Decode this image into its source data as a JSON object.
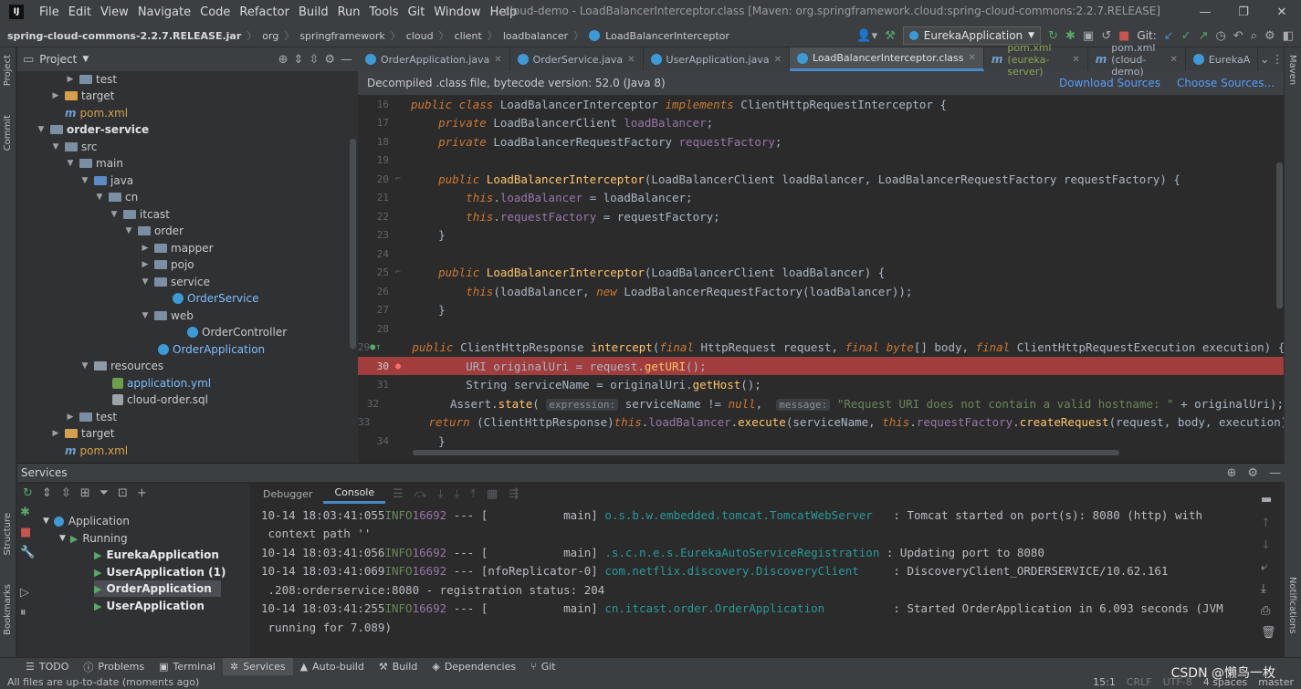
{
  "menubar": {
    "items": [
      "File",
      "Edit",
      "View",
      "Navigate",
      "Code",
      "Refactor",
      "Build",
      "Run",
      "Tools",
      "Git",
      "Window",
      "Help"
    ],
    "title": "cloud-demo - LoadBalancerInterceptor.class [Maven: org.springframework.cloud:spring-cloud-commons:2.2.7.RELEASE]"
  },
  "navbar": {
    "crumbs": [
      "spring-cloud-commons-2.2.7.RELEASE.jar",
      "org",
      "springframework",
      "cloud",
      "client",
      "loadbalancer",
      "LoadBalancerInterceptor"
    ],
    "run_config": "EurekaApplication",
    "git_label": "Git:"
  },
  "left_strip": {
    "project": "Project",
    "commit": "Commit",
    "structure": "Structure",
    "bookmarks": "Bookmarks"
  },
  "right_strip": {
    "maven": "Maven",
    "notifications": "Notifications"
  },
  "project": {
    "title": "Project",
    "tree": [
      {
        "label": "test",
        "icon": "folder"
      },
      {
        "label": "target",
        "icon": "folder-target"
      },
      {
        "label": "pom.xml",
        "icon": "maven"
      },
      {
        "label": "order-service",
        "icon": "module"
      },
      {
        "label": "src",
        "icon": "folder"
      },
      {
        "label": "main",
        "icon": "folder"
      },
      {
        "label": "java",
        "icon": "folder-src"
      },
      {
        "label": "cn",
        "icon": "package"
      },
      {
        "label": "itcast",
        "icon": "package"
      },
      {
        "label": "order",
        "icon": "package"
      },
      {
        "label": "mapper",
        "icon": "package"
      },
      {
        "label": "pojo",
        "icon": "package"
      },
      {
        "label": "service",
        "icon": "package"
      },
      {
        "label": "OrderService",
        "icon": "class"
      },
      {
        "label": "web",
        "icon": "package"
      },
      {
        "label": "OrderController",
        "icon": "class"
      },
      {
        "label": "OrderApplication",
        "icon": "class"
      },
      {
        "label": "resources",
        "icon": "folder-res"
      },
      {
        "label": "application.yml",
        "icon": "yml"
      },
      {
        "label": "cloud-order.sql",
        "icon": "sql"
      },
      {
        "label": "test",
        "icon": "folder"
      },
      {
        "label": "target",
        "icon": "folder-target"
      },
      {
        "label": "pom.xml",
        "icon": "maven"
      }
    ]
  },
  "editor": {
    "tabs": [
      {
        "label": "OrderApplication.java",
        "icon": "class"
      },
      {
        "label": "OrderService.java",
        "icon": "class"
      },
      {
        "label": "UserApplication.java",
        "icon": "class"
      },
      {
        "label": "LoadBalancerInterceptor.class",
        "icon": "class"
      },
      {
        "label": "pom.xml (eureka-server)",
        "icon": "maven"
      },
      {
        "label": "pom.xml (cloud-demo)",
        "icon": "maven"
      },
      {
        "label": "EurekaA",
        "icon": "class"
      }
    ],
    "banner_text": "Decompiled .class file, bytecode version: 52.0 (Java 8)",
    "download_sources": "Download Sources",
    "choose_sources": "Choose Sources...",
    "line_numbers": [
      "16",
      "17",
      "18",
      "19",
      "20",
      "21",
      "22",
      "23",
      "24",
      "25",
      "26",
      "27",
      "28",
      "29",
      "30",
      "31",
      "32",
      "33",
      "34"
    ],
    "hint_expression": "expression:",
    "hint_message": "message:"
  },
  "services": {
    "title": "Services",
    "tree": [
      {
        "label": "Application"
      },
      {
        "label": "Running"
      },
      {
        "label": "EurekaApplication"
      },
      {
        "label": "UserApplication (1)"
      },
      {
        "label": "OrderApplication"
      },
      {
        "label": "UserApplication"
      }
    ],
    "console_tabs": [
      "Debugger",
      "Console"
    ],
    "log": [
      {
        "time": "10-14 18:03:41:055",
        "level": "INFO",
        "pid": "16692",
        "sep": " --- [",
        "thread": "           main]",
        "logger": " o.s.b.w.embedded.tomcat.TomcatWebServer  ",
        "msg": " : Tomcat started on port(s): 8080 (http) with"
      },
      {
        "cont": " context path ''"
      },
      {
        "time": "10-14 18:03:41:056",
        "level": "INFO",
        "pid": "16692",
        "sep": " --- [",
        "thread": "           main]",
        "logger": " .s.c.n.e.s.EurekaAutoServiceRegistration",
        "msg": " : Updating port to 8080"
      },
      {
        "time": "10-14 18:03:41:069",
        "level": "INFO",
        "pid": "16692",
        "sep": " --- [",
        "thread": "nfoReplicator-0]",
        "logger": " com.netflix.discovery.DiscoveryClient    ",
        "msg": " : DiscoveryClient_ORDERSERVICE/10.62.161"
      },
      {
        "cont": " .208:orderservice:8080 - registration status: 204"
      },
      {
        "time": "10-14 18:03:41:255",
        "level": "INFO",
        "pid": "16692",
        "sep": " --- [",
        "thread": "           main]",
        "logger": " cn.itcast.order.OrderApplication         ",
        "msg": " : Started OrderApplication in 6.093 seconds (JVM"
      },
      {
        "cont": " running for 7.089)"
      }
    ]
  },
  "bottom_tools": [
    "TODO",
    "Problems",
    "Terminal",
    "Services",
    "Auto-build",
    "Build",
    "Dependencies",
    "Git"
  ],
  "status": {
    "left": "All files are up-to-date (moments ago)",
    "position": "15:1",
    "line_sep": "CRLF",
    "encoding": "UTF-8",
    "indent": "4 spaces",
    "branch": "master"
  },
  "watermark": "CSDN @懒鸟一枚"
}
